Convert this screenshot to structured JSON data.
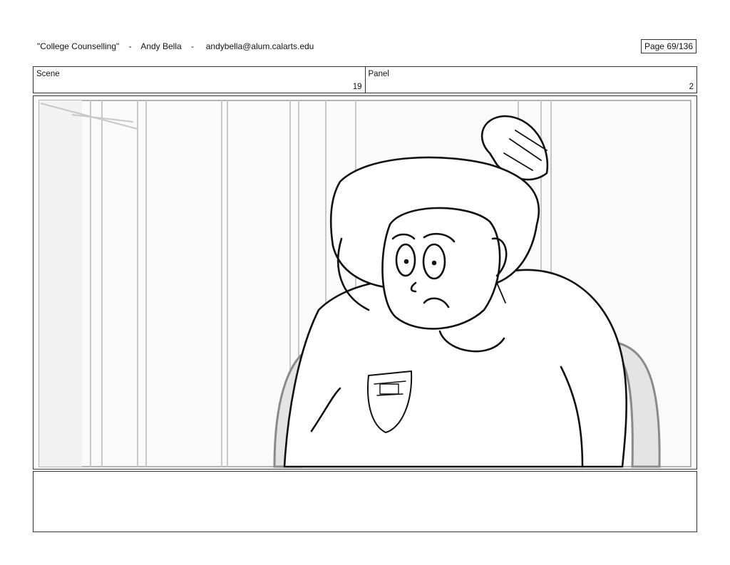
{
  "header": {
    "title": "\"College Counselling\"",
    "sep1": "-",
    "author": "Andy Bella",
    "sep2": "-",
    "email": "andybella@alum.calarts.edu",
    "page_label": "Page",
    "page_value": "69/136"
  },
  "scene": {
    "label": "Scene",
    "value": "19"
  },
  "panel": {
    "label": "Panel",
    "value": "2"
  },
  "notes": {
    "text": ""
  }
}
